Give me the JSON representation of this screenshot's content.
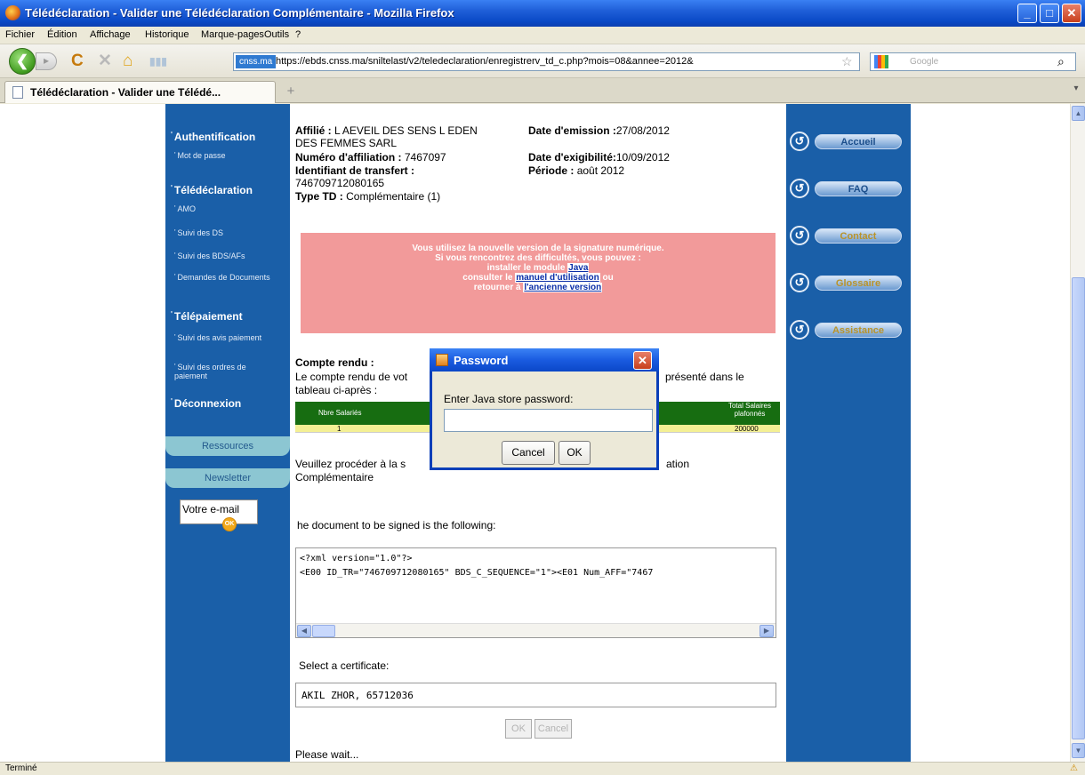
{
  "window": {
    "title": "Télédéclaration - Valider une Télédéclaration Complémentaire - Mozilla Firefox",
    "minimize": "_",
    "maximize": "□",
    "close": "✕"
  },
  "menu": [
    "Fichier",
    "Édition",
    "Affichage",
    "Historique",
    "Marque-pages",
    "Outils",
    "?"
  ],
  "nav": {
    "back": "❮",
    "forward": "▸",
    "reload": "C",
    "stop": "✕",
    "home": "⌂",
    "site_badge": "cnss.ma",
    "url": "https://ebds.cnss.ma/sniltelast/v2/teledeclaration/enregistrerv_td_c.php?mois=08&annee=2012&",
    "search_placeholder": "Google"
  },
  "tab": {
    "title": "Télédéclaration - Valider une Télédé...",
    "new_tab": "+"
  },
  "left_nav": {
    "sections": [
      {
        "label": "Authentification",
        "items": [
          "Mot de passe"
        ]
      },
      {
        "label": "Télédéclaration",
        "items": [
          "AMO",
          "Suivi des DS",
          "Suivi des BDS/AFs",
          "Demandes de Documents"
        ]
      },
      {
        "label": "Télépaiement",
        "items": [
          "Suivi des avis paiement",
          "Suivi des ordres de paiement"
        ]
      },
      {
        "label": "Déconnexion",
        "items": []
      }
    ],
    "ressources": "Ressources",
    "newsletter": "Newsletter",
    "email_placeholder": "Votre e-mail",
    "ok": "OK"
  },
  "right_nav": [
    "Accueil",
    "FAQ",
    "Contact",
    "Glossaire",
    "Assistance"
  ],
  "info": {
    "affilie_label": "Affilié :",
    "affilie_value": "L AEVEIL DES SENS L EDEN DES FEMMES SARL",
    "affilie_line1": "L AEVEIL DES SENS L EDEN",
    "affilie_line2": "DES FEMMES SARL",
    "num_label": "Numéro d'affiliation :",
    "num_value": "7467097",
    "ident_label": "Identifiant de transfert :",
    "ident_value": "746709712080165",
    "type_label": "Type TD :",
    "type_value": "Complémentaire (1)",
    "emission_label": "Date d'emission :",
    "emission_value": "27/08/2012",
    "exig_label": "Date d'exigibilité:",
    "exig_value": "10/09/2012",
    "periode_label": "Période :",
    "periode_value": "août 2012"
  },
  "notice": {
    "line1": "Vous utilisez la nouvelle version de la signature numérique.",
    "line2": "Si vous rencontrez des difficultés, vous pouvez :",
    "line3_prefix": "installer le module",
    "link_java": "Java",
    "line4_prefix": "consulter le",
    "link_manuel": "manuel d'utilisation",
    "line4_suffix": "ou",
    "line5_prefix": "retourner à",
    "link_ancienne": "l'ancienne version"
  },
  "compte_rendu": {
    "title": "Compte rendu :",
    "text1_left": "Le compte rendu de vot",
    "text1_right": "présenté dans le",
    "text2": "tableau ci-après :",
    "headers": [
      "Nbre Salariés",
      "Total Salaires plafonnés"
    ],
    "row": [
      "1",
      "200000"
    ],
    "sign_left": "Veuillez procéder à la s",
    "sign_right": "ation",
    "sign_line2": "Complémentaire"
  },
  "applet": {
    "doc_label": "he document to be signed is the following:",
    "xml_line1": "<?xml version=\"1.0\"?>",
    "xml_line2": "<E00 ID_TR=\"746709712080165\" BDS_C_SEQUENCE=\"1\"><E01 Num_AFF=\"7467",
    "select_label": "Select a certificate:",
    "certificate": "AKIL ZHOR, 65712036",
    "ok": "OK",
    "cancel": "Cancel",
    "wait": "Please wait..."
  },
  "dialog": {
    "title": "Password",
    "prompt": "Enter Java store password:",
    "password_value": "",
    "cancel": "Cancel",
    "ok": "OK"
  },
  "status": {
    "text": "Terminé"
  }
}
